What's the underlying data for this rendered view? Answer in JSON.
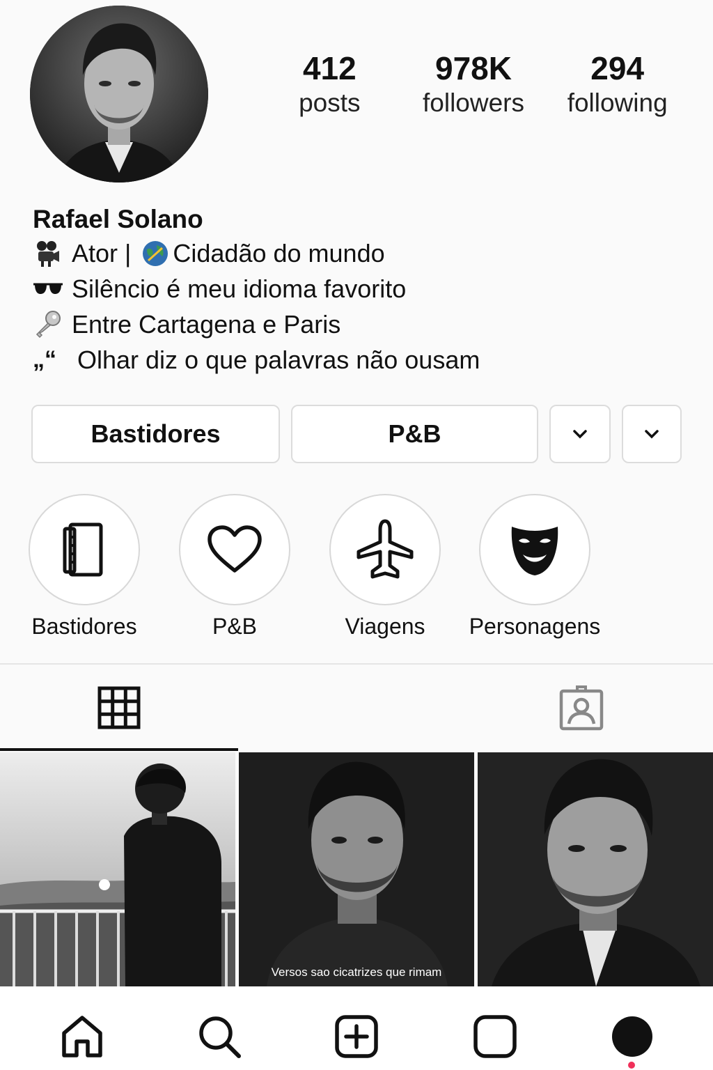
{
  "profile": {
    "name": "Rafael Solano",
    "stats": [
      {
        "num": "412",
        "label": "posts"
      },
      {
        "num": "978K",
        "label": "followers"
      },
      {
        "num": "294",
        "label": "following"
      }
    ],
    "bio": [
      {
        "icon": "movie-camera-icon",
        "text": "Ator | "
      },
      {
        "icon": "sunglasses-icon",
        "text": "Silêncio é meu idioma favorito"
      },
      {
        "icon": "key-icon",
        "text": "Entre Cartagena e Paris"
      },
      {
        "icon": "quote-icon",
        "text": "Olhar diz o que palavras não ousam"
      }
    ],
    "bio_line1_after_globe": "Cidadão do mundo",
    "quote_mark": "„“"
  },
  "buttons": {
    "bastidores": "Bastidores",
    "pb": "P&B"
  },
  "highlights": [
    {
      "label": "Bastidores",
      "icon": "notebook-icon"
    },
    {
      "label": "P&B",
      "icon": "heart-icon"
    },
    {
      "label": "Viagens",
      "icon": "airplane-icon"
    },
    {
      "label": "Personagens",
      "icon": "theater-mask-icon"
    }
  ],
  "tabs": [
    {
      "name": "grid",
      "icon": "grid-icon",
      "active": true
    },
    {
      "name": "tagged",
      "icon": "tagged-portrait-icon",
      "active": false
    }
  ],
  "posts": [
    {
      "caption": ""
    },
    {
      "caption": "Versos sao cicatrizes que rimam"
    },
    {
      "caption": ""
    }
  ],
  "bottom_nav": [
    "home-icon",
    "search-icon",
    "create-icon",
    "reels-icon",
    "profile-icon"
  ],
  "colors": {
    "notification_dot": "#f0305a"
  }
}
